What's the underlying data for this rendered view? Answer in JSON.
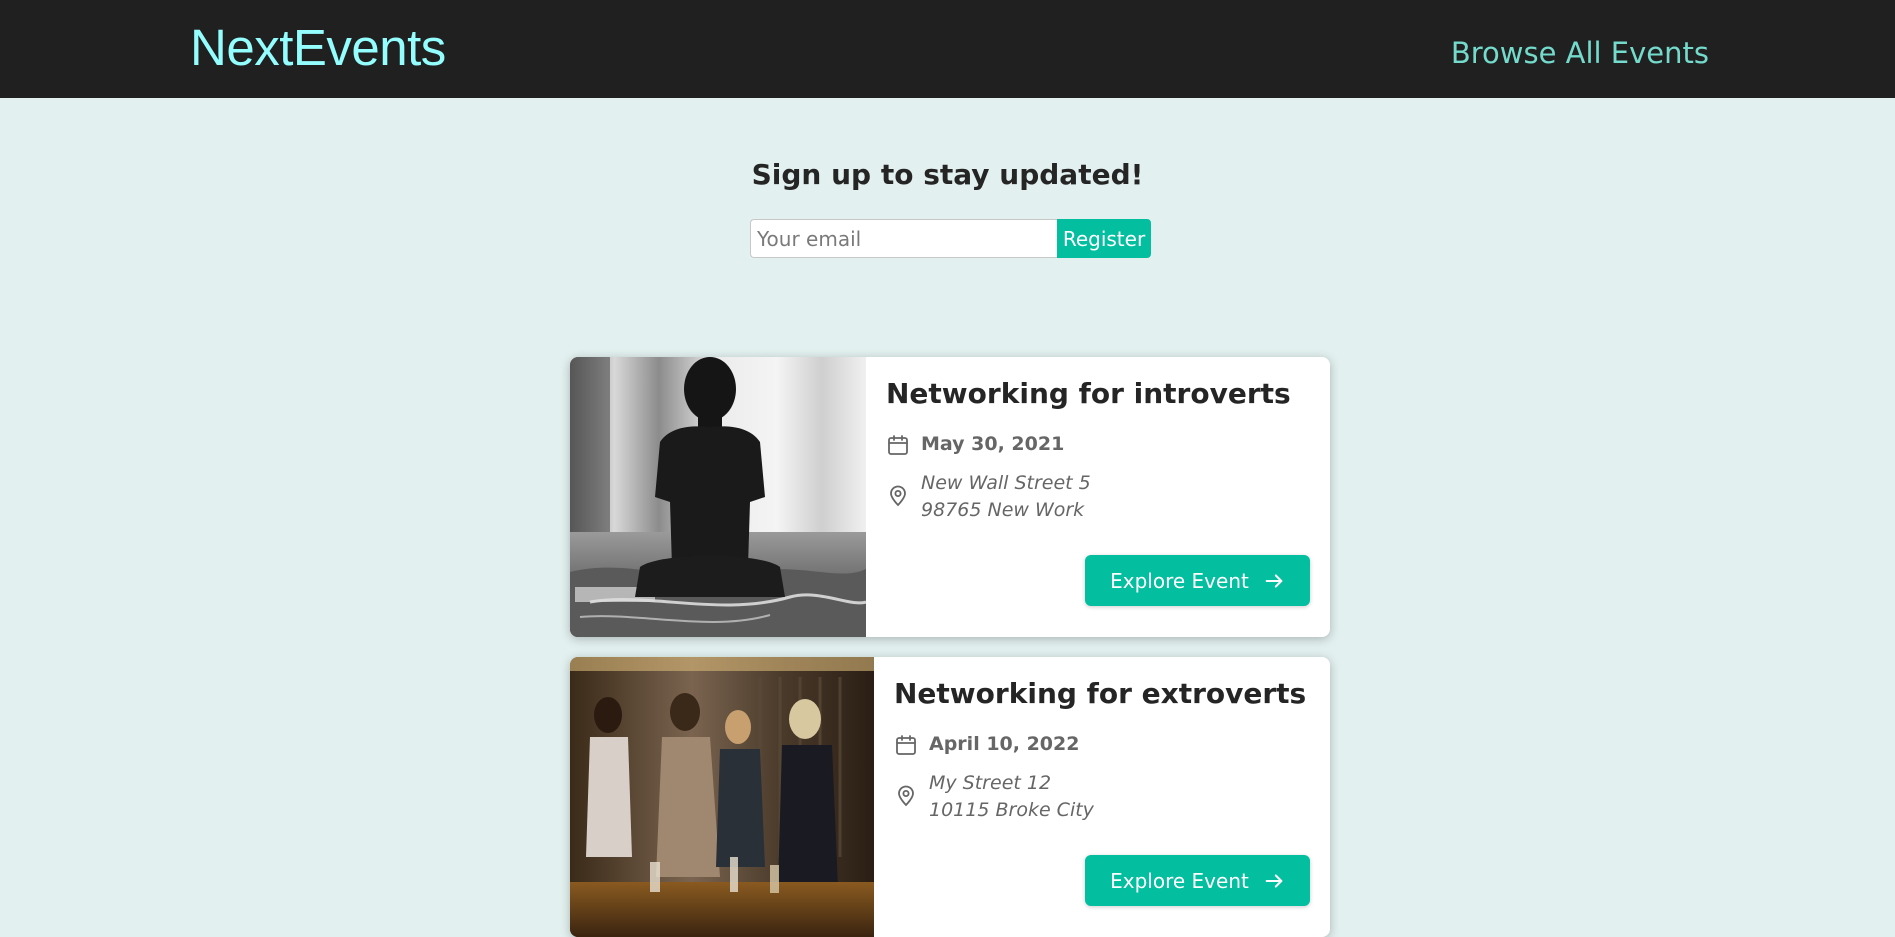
{
  "header": {
    "logo": "NextEvents",
    "nav_link": "Browse All Events"
  },
  "signup": {
    "title": "Sign up to stay updated!",
    "email_placeholder": "Your email",
    "register_label": "Register"
  },
  "events": [
    {
      "title": "Networking for introverts",
      "date": "May 30, 2021",
      "address_line1": "New Wall Street 5",
      "address_line2": "98765 New Work",
      "button_label": "Explore Event"
    },
    {
      "title": "Networking for extroverts",
      "date": "April 10, 2022",
      "address_line1": "My Street 12",
      "address_line2": "10115 Broke City",
      "button_label": "Explore Event"
    }
  ],
  "colors": {
    "header_bg": "#202020",
    "logo": "#94fdfd",
    "nav_link": "#74dacc",
    "page_bg": "#e2f0ef",
    "accent": "#03be9f"
  },
  "icons": [
    "calendar-icon",
    "location-pin-icon",
    "arrow-right-icon"
  ]
}
